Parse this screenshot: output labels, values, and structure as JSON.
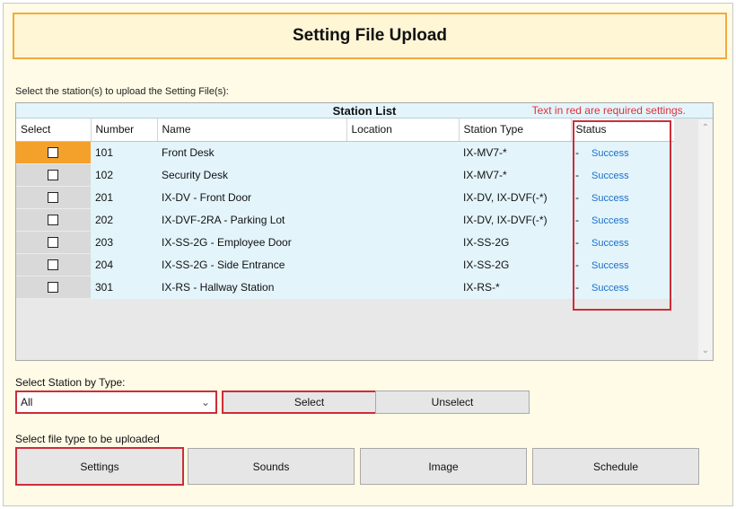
{
  "title": "Setting File Upload",
  "instructions": "Select the station(s) to upload the Setting File(s):",
  "station_list": {
    "title": "Station List",
    "required_note": "Text in red are required settings.",
    "columns": [
      "Select",
      "Number",
      "Name",
      "Location",
      "Station Type",
      "Status"
    ],
    "rows": [
      {
        "number": "101",
        "name": "Front Desk",
        "location": "",
        "station_type": "IX-MV7-*",
        "status_prefix": "-",
        "status": "Success"
      },
      {
        "number": "102",
        "name": "Security Desk",
        "location": "",
        "station_type": "IX-MV7-*",
        "status_prefix": "-",
        "status": "Success"
      },
      {
        "number": "201",
        "name": "IX-DV - Front Door",
        "location": "",
        "station_type": "IX-DV, IX-DVF(-*)",
        "status_prefix": "-",
        "status": "Success"
      },
      {
        "number": "202",
        "name": "IX-DVF-2RA - Parking Lot",
        "location": "",
        "station_type": "IX-DV, IX-DVF(-*)",
        "status_prefix": "-",
        "status": "Success"
      },
      {
        "number": "203",
        "name": "IX-SS-2G - Employee Door",
        "location": "",
        "station_type": "IX-SS-2G",
        "status_prefix": "-",
        "status": "Success"
      },
      {
        "number": "204",
        "name": "IX-SS-2G - Side Entrance",
        "location": "",
        "station_type": "IX-SS-2G",
        "status_prefix": "-",
        "status": "Success"
      },
      {
        "number": "301",
        "name": "IX-RS - Hallway Station",
        "location": "",
        "station_type": "IX-RS-*",
        "status_prefix": "-",
        "status": "Success"
      }
    ]
  },
  "select_by_type": {
    "label": "Select Station by Type:",
    "selected": "All",
    "select_button": "Select",
    "unselect_button": "Unselect"
  },
  "file_type": {
    "label": "Select file type to be uploaded",
    "buttons": [
      "Settings",
      "Sounds",
      "Image",
      "Schedule"
    ]
  },
  "colors": {
    "highlight": "#cc2d3a",
    "title_border": "#f4a93c",
    "status_text": "#1b6fc9",
    "selected_row": "#f4a12c"
  }
}
